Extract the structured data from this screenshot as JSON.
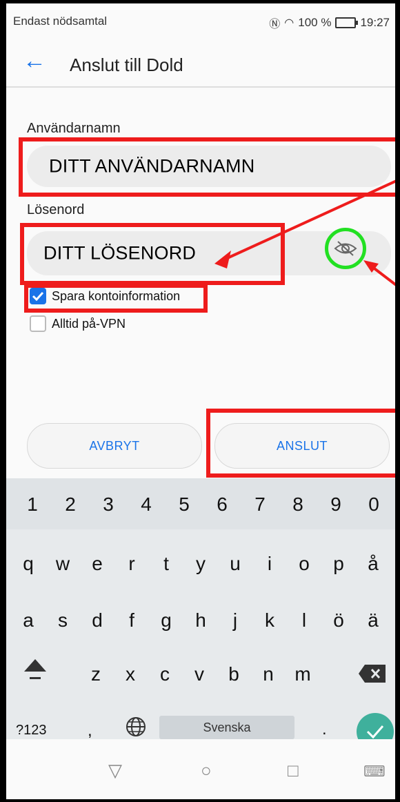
{
  "status_bar": {
    "left_text": "Endast nödsamtal",
    "battery_text": "100 %",
    "time": "19:27"
  },
  "app_bar": {
    "title": "Anslut till Dold"
  },
  "username": {
    "label": "Användarnamn",
    "value": "DITT ANVÄNDARNAMN"
  },
  "password": {
    "label": "Lösenord",
    "value": "DITT LÖSENORD"
  },
  "options": {
    "save_label": "Spara kontoinformation",
    "save_checked": true,
    "vpn_label": "Alltid på-VPN",
    "vpn_checked": false
  },
  "buttons": {
    "cancel": "AVBRYT",
    "connect": "ANSLUT"
  },
  "keyboard": {
    "numbers": [
      "1",
      "2",
      "3",
      "4",
      "5",
      "6",
      "7",
      "8",
      "9",
      "0"
    ],
    "row1": [
      "q",
      "w",
      "e",
      "r",
      "t",
      "y",
      "u",
      "i",
      "o",
      "p",
      "å"
    ],
    "row2": [
      "a",
      "s",
      "d",
      "f",
      "g",
      "h",
      "j",
      "k",
      "l",
      "ö",
      "ä"
    ],
    "row3": [
      "z",
      "x",
      "c",
      "v",
      "b",
      "n",
      "m"
    ],
    "symbols_key": "?123",
    "comma": ",",
    "space_label": "Svenska",
    "period": "."
  },
  "colors": {
    "accent": "#1a73e8",
    "annotation_red": "#ee1c1c",
    "annotation_green": "#22e022",
    "enter": "#3fb09c"
  }
}
